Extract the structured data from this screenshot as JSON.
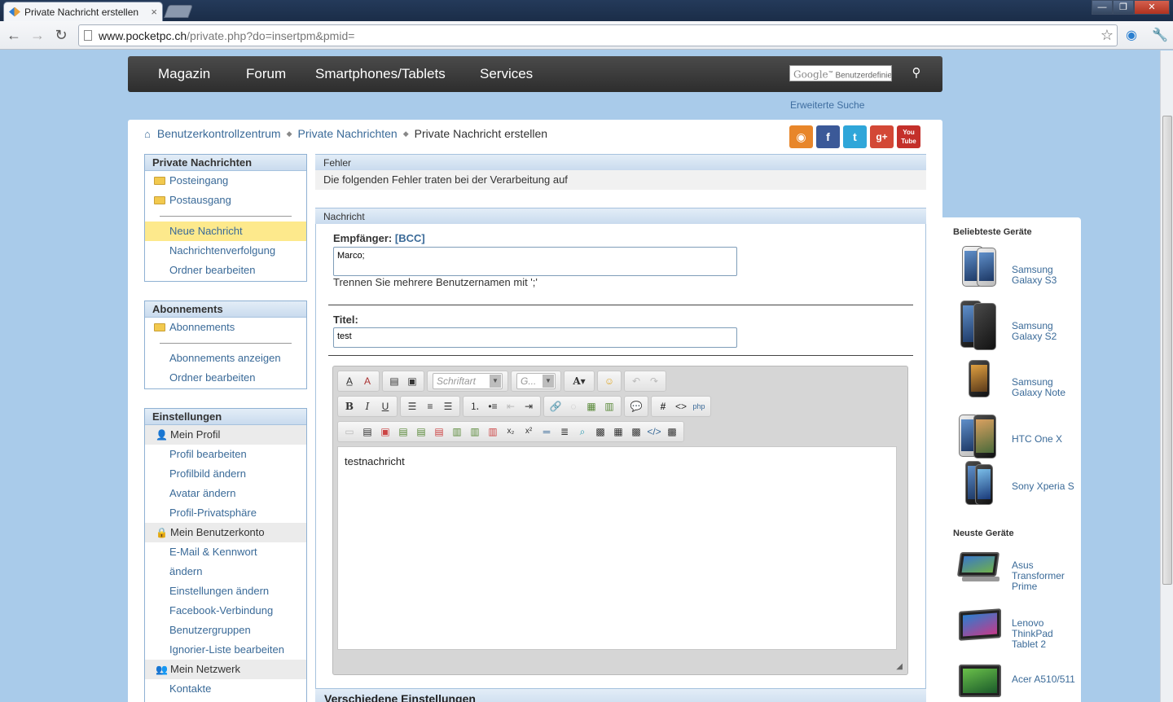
{
  "browser": {
    "tab_title": "Private Nachricht erstellen",
    "tab_close": "×",
    "url_host": "www.pocketpc.ch",
    "url_path": "/private.php?do=insertpm&pmid=",
    "win_minimize": "—",
    "win_maximize": "❐",
    "win_close": "✕",
    "icons": [
      "back-icon",
      "forward-icon",
      "reload-icon",
      "star-icon",
      "extension-icon",
      "wrench-icon"
    ]
  },
  "nav": {
    "items": [
      "Magazin",
      "Forum",
      "Smartphones/Tablets",
      "Services"
    ],
    "search_google": "Google",
    "search_placeholder": "Benutzerdefiniert",
    "search_tm": "™",
    "advanced_search": "Erweiterte Suche"
  },
  "breadcrumb": {
    "items": [
      "Benutzerkontrollzentrum",
      "Private Nachrichten"
    ],
    "current": "Private Nachricht erstellen"
  },
  "social": [
    {
      "name": "rss-icon",
      "glyph": "◉",
      "color": "#e8862a"
    },
    {
      "name": "facebook-icon",
      "glyph": "f",
      "color": "#3b5998"
    },
    {
      "name": "twitter-icon",
      "glyph": "t",
      "color": "#2fa6d9"
    },
    {
      "name": "googleplus-icon",
      "glyph": "g+",
      "color": "#d34836"
    },
    {
      "name": "youtube-icon",
      "glyph": "You Tube",
      "color": "#c4302b"
    }
  ],
  "sidebar": {
    "pm": {
      "title": "Private Nachrichten",
      "folders": [
        "Posteingang",
        "Postausgang"
      ],
      "links": [
        "Neue Nachricht",
        "Nachrichtenverfolgung",
        "Ordner bearbeiten"
      ]
    },
    "subs": {
      "title": "Abonnements",
      "folders": [
        "Abonnements"
      ],
      "links": [
        "Abonnements anzeigen",
        "Ordner bearbeiten"
      ]
    },
    "settings": {
      "title": "Einstellungen",
      "profile_group": "Mein Profil",
      "profile_links": [
        "Profil bearbeiten",
        "Profilbild ändern",
        "Avatar ändern",
        "Profil-Privatsphäre"
      ],
      "account_group": "Mein Benutzerkonto",
      "account_links": [
        "E-Mail & Kennwort",
        "ändern",
        "Einstellungen ändern",
        "Facebook-Verbindung",
        "Benutzergruppen",
        "Ignorier-Liste bearbeiten"
      ],
      "network_group": "Mein Netzwerk",
      "network_links": [
        "Kontakte"
      ]
    }
  },
  "error_panel": {
    "title": "Fehler",
    "message": "Die folgenden Fehler traten bei der Verarbeitung auf"
  },
  "message_panel": {
    "title": "Nachricht",
    "recipient_label": "Empfänger:",
    "bcc_label": "[BCC]",
    "recipient_value": "Marco;",
    "recipient_hint": "Trennen Sie mehrere Benutzernamen mit ';'",
    "title_label": "Titel:",
    "title_value": "test",
    "font_combo": "Schriftart",
    "size_combo": "G...",
    "body": "testnachricht"
  },
  "misc_header": "Verschiedene Einstellungen",
  "rail": {
    "popular_title": "Beliebteste Geräte",
    "popular": [
      {
        "name": "Samsung Galaxy S3"
      },
      {
        "name": "Samsung Galaxy S2"
      },
      {
        "name": "Samsung Galaxy Note"
      },
      {
        "name": "HTC One X"
      },
      {
        "name": "Sony Xperia S"
      }
    ],
    "new_title": "Neuste Geräte",
    "newest": [
      {
        "name": "Asus Transformer Prime"
      },
      {
        "name": "Lenovo ThinkPad Tablet 2"
      },
      {
        "name": "Acer A510/511"
      }
    ]
  }
}
